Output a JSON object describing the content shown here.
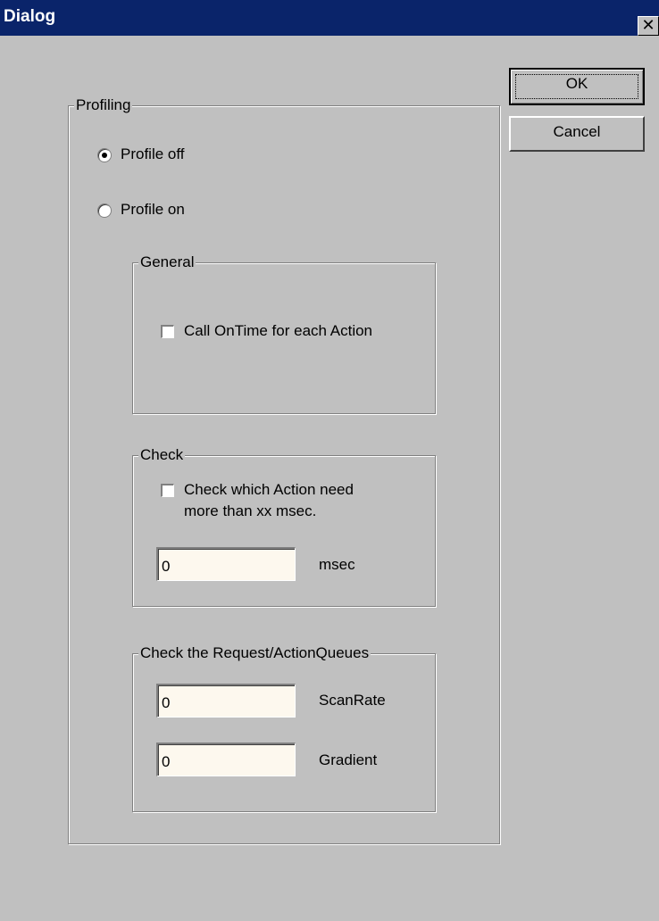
{
  "window": {
    "title": "Dialog",
    "close_glyph": "✕"
  },
  "buttons": {
    "ok": "OK",
    "cancel": "Cancel"
  },
  "profiling": {
    "legend": "Profiling",
    "radio_off": {
      "label": "Profile off",
      "selected": true
    },
    "radio_on": {
      "label": "Profile on",
      "selected": false
    }
  },
  "general": {
    "legend": "General",
    "call_ontime": {
      "label": "Call OnTime for each Action",
      "checked": false
    }
  },
  "check": {
    "legend": "Check",
    "check_actions": {
      "line1": "Check which Action need",
      "line2": "more than xx msec.",
      "checked": false
    },
    "msec_value": "0",
    "msec_label": "msec"
  },
  "queues": {
    "legend": "Check the Request/ActionQueues",
    "scanrate_value": "0",
    "scanrate_label": "ScanRate",
    "gradient_value": "0",
    "gradient_label": "Gradient"
  }
}
